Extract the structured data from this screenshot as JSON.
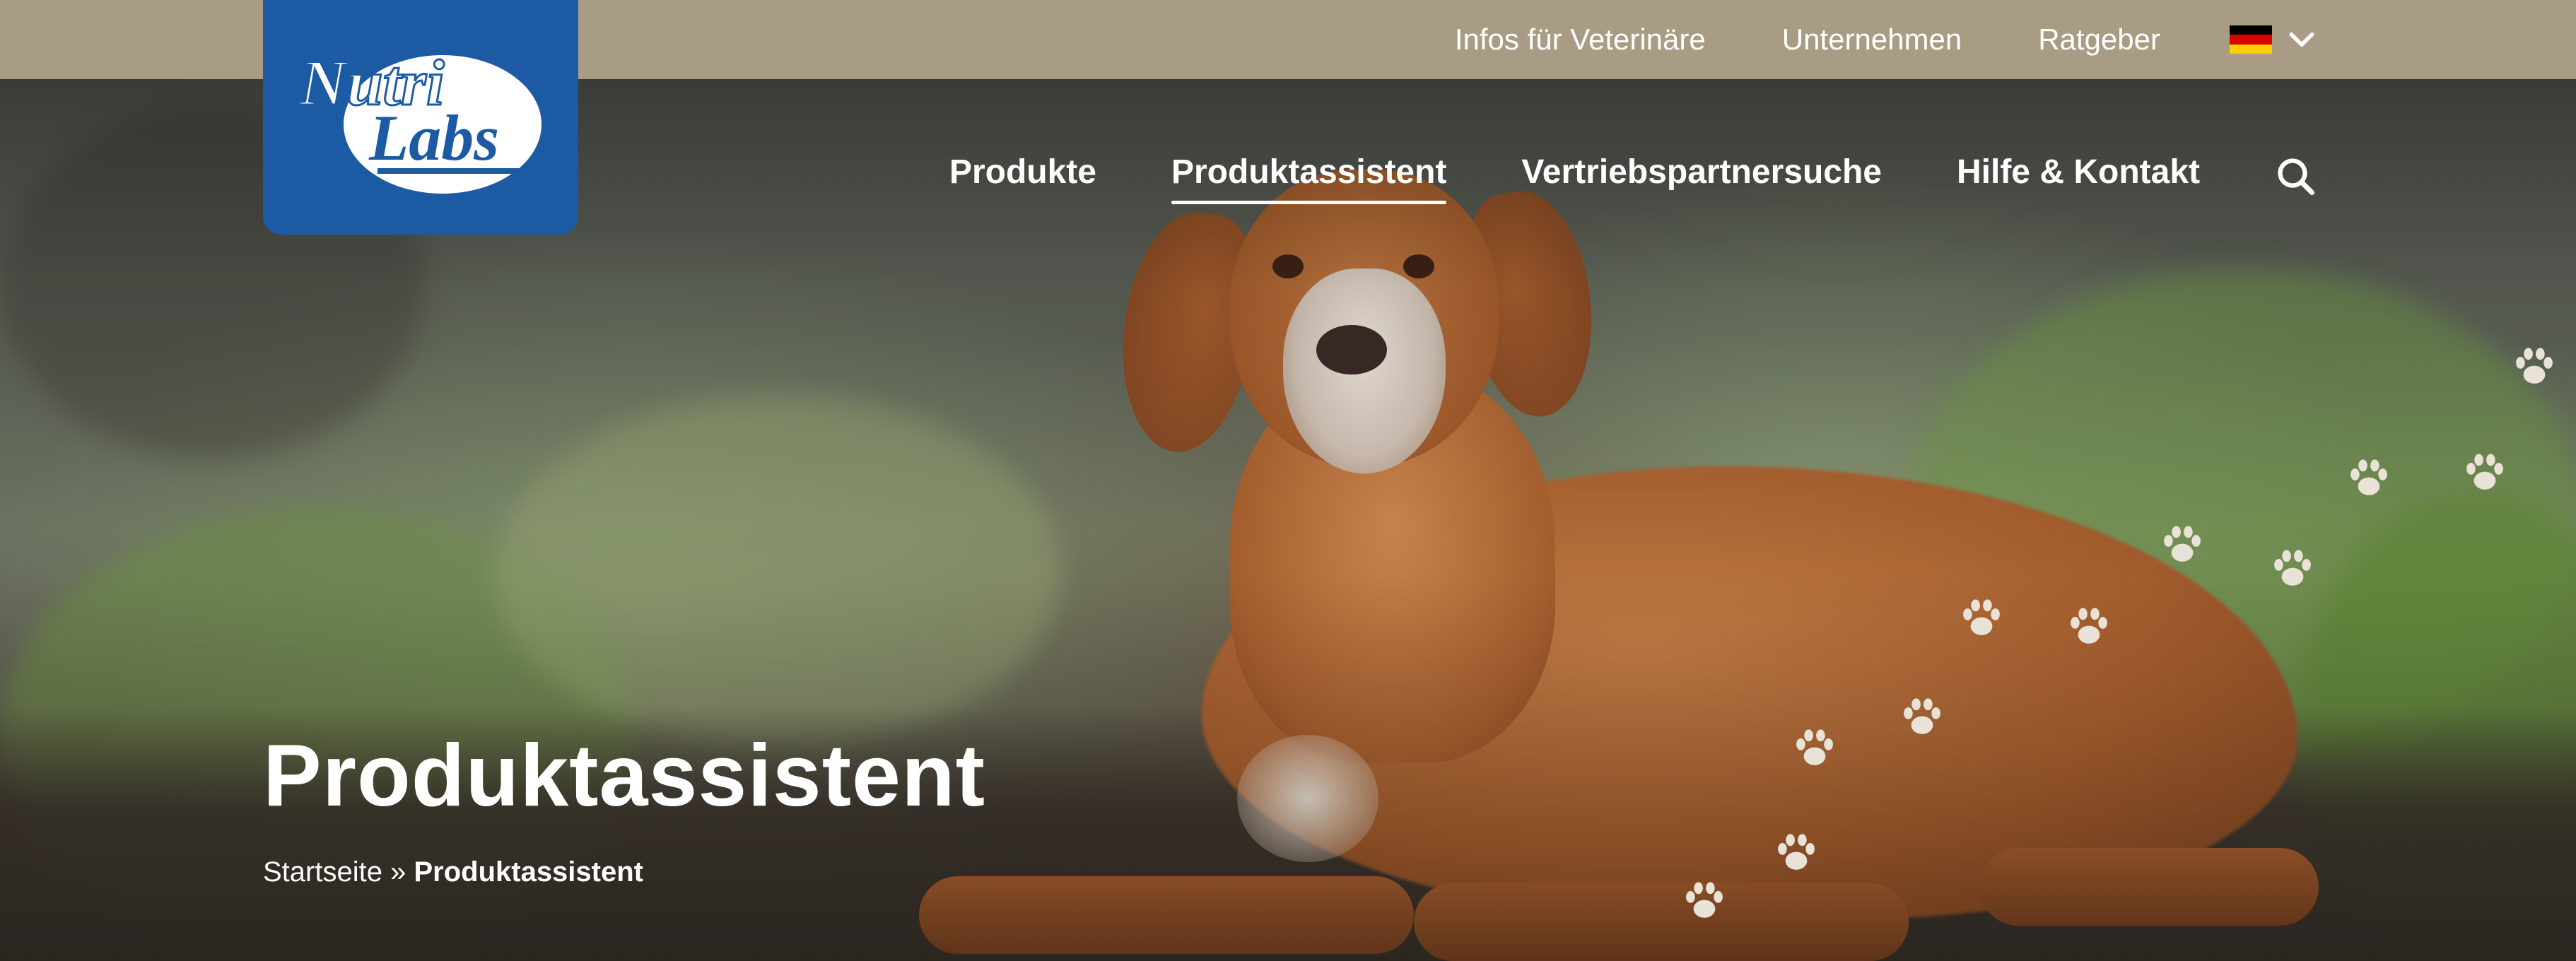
{
  "topbar": {
    "links": [
      "Infos für Veterinäre",
      "Unternehmen",
      "Ratgeber"
    ],
    "language_flag": "de-flag-icon"
  },
  "logo": {
    "line1": "Nutri",
    "line2": "Labs",
    "brand_color": "#1c5ba4"
  },
  "mainnav": {
    "items": [
      "Produkte",
      "Produktassistent",
      "Vertriebspartnersuche",
      "Hilfe & Kontakt"
    ],
    "active": "Produktassistent",
    "search_icon": "search-icon"
  },
  "hero": {
    "title": "Produktassistent",
    "breadcrumb": {
      "home": "Startseite",
      "separator": "»",
      "current": "Produktassistent"
    }
  },
  "colors": {
    "topbar": "#a99c84",
    "logo_bg": "#1c5ba4",
    "text": "#ffffff"
  }
}
